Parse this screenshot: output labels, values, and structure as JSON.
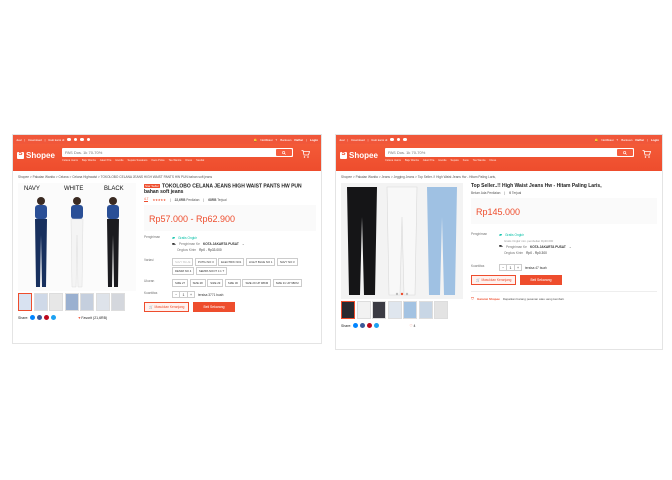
{
  "left": {
    "topbar": {
      "left_items": [
        "Jual",
        "Download",
        "Ikuti kami di"
      ],
      "right_items": [
        "Notifikasi",
        "Bantuan",
        "Daftar",
        "Login"
      ]
    },
    "header": {
      "logo_text": "Shopee",
      "search_placeholder": "PAS Dos. 1k 70-70%",
      "search_button_icon": "search-icon",
      "hints": [
        "Celana Jeans",
        "Baju Wanita",
        "Jaket Pria",
        "Hoodie",
        "Sepatu Sneakers",
        "Kaos Polos",
        "Tas Wanita",
        "Dress",
        "Sandal"
      ],
      "cart_icon": "cart-icon"
    },
    "breadcrumb": "Shopee  >  Pakaian Wanita  >  Celana  >  Celana Highwaist  >  TOKOLOBO CELANA JEANS HIGH WAIST PANTS HW PUN bahan soft jeans",
    "gallery": {
      "color_labels": [
        "NAVY",
        "WHITE",
        "BLACK"
      ]
    },
    "product": {
      "tag": "Star Seller",
      "title": "TOKOLOBO CELANA JEANS HIGH WAIST PANTS HW PUN bahan soft jeans",
      "rating": "4.7",
      "stars": "★★★★★",
      "ratings_count": "22,6RB",
      "ratings_label": "Penilaian",
      "sold_count": "68RB",
      "sold_label": "Terjual",
      "price": "Rp57.000 - Rp62.900",
      "shipping_label": "Pengiriman",
      "free_shipping": "Gratis Ongkir",
      "ship_to_label": "Pengiriman Ke",
      "ship_to_value": "KOTA JAKARTA PUSAT",
      "ship_cost_label": "Ongkos Kirim",
      "ship_cost_value": "Rp0 - Rp33.000",
      "variant_label": "Variasi",
      "variants": [
        "NAVY BLUE",
        "PUTIH NO 3",
        "ELECTRIK NO1",
        "LIGHT BLUE NO 1",
        "NAVY NO 3",
        "DENIM NO 4",
        "SEMPA NOOT 4 1 T"
      ],
      "size_label": "Ukuran",
      "sizes": [
        "SIZE 27",
        "SIZE 28",
        "SIZE 29",
        "SIZE 30",
        "SIZE 29 UP 98KM",
        "SIZE 31 UP 98KM"
      ],
      "qty_label": "Kuantitas",
      "qty_value": "1",
      "stock": "tersisa 3771 buah",
      "add_to_cart": "Masukkan Keranjang",
      "buy_now": "Beli Sekarang",
      "share_label": "Share:",
      "favorite": "Favorit (21,6RB)"
    }
  },
  "right": {
    "topbar": {
      "left_items": [
        "Jual",
        "Download",
        "Ikuti kami di"
      ],
      "right_items": [
        "Notifikasi",
        "Bantuan",
        "Daftar",
        "Login"
      ]
    },
    "header": {
      "logo_text": "Shopee",
      "search_placeholder": "PAS Dos. 1k 70-70%",
      "hints": [
        "Celana Jeans",
        "Baju Wanita",
        "Jaket Pria",
        "Hoodie",
        "Sepatu",
        "Kaos",
        "Tas Wanita",
        "Dress"
      ],
      "cart_icon": "cart-icon"
    },
    "breadcrumb": "Shopee  >  Pakaian Wanita  >  Jeans  >  Jegging Jeans  >  Top Seller..!! High Waist Jeans Hw - Hitam Paling Laris,",
    "product": {
      "title": "Top Seller..!! High Waist Jeans Hw - Hitam Paling Laris,",
      "no_rating": "Belum Ada Penilaian",
      "sold_count": "0",
      "sold_label": "Terjual",
      "price": "Rp145.000",
      "shipping_label": "Pengiriman",
      "free_shipping": "Gratis Ongkir",
      "free_note": "Gratis Ongkir min. pembelian Rp30.000",
      "ship_to_label": "Pengiriman Ke",
      "ship_to_value": "KOTA JAKARTA PUSAT",
      "ship_cost_label": "Ongkos Kirim",
      "ship_cost_value": "Rp0 - Rp0.300",
      "qty_label": "Kuantitas",
      "qty_value": "1",
      "stock": "tersisa 47 buah",
      "add_to_cart": "Masukkan Keranjang",
      "buy_now": "Beli Sekarang",
      "guarantee_title": "Garansi Shopee",
      "guarantee_text": "Dapatkan barang pesanan atau uang kembali.",
      "share_label": "Share:",
      "favorite": "4"
    }
  }
}
